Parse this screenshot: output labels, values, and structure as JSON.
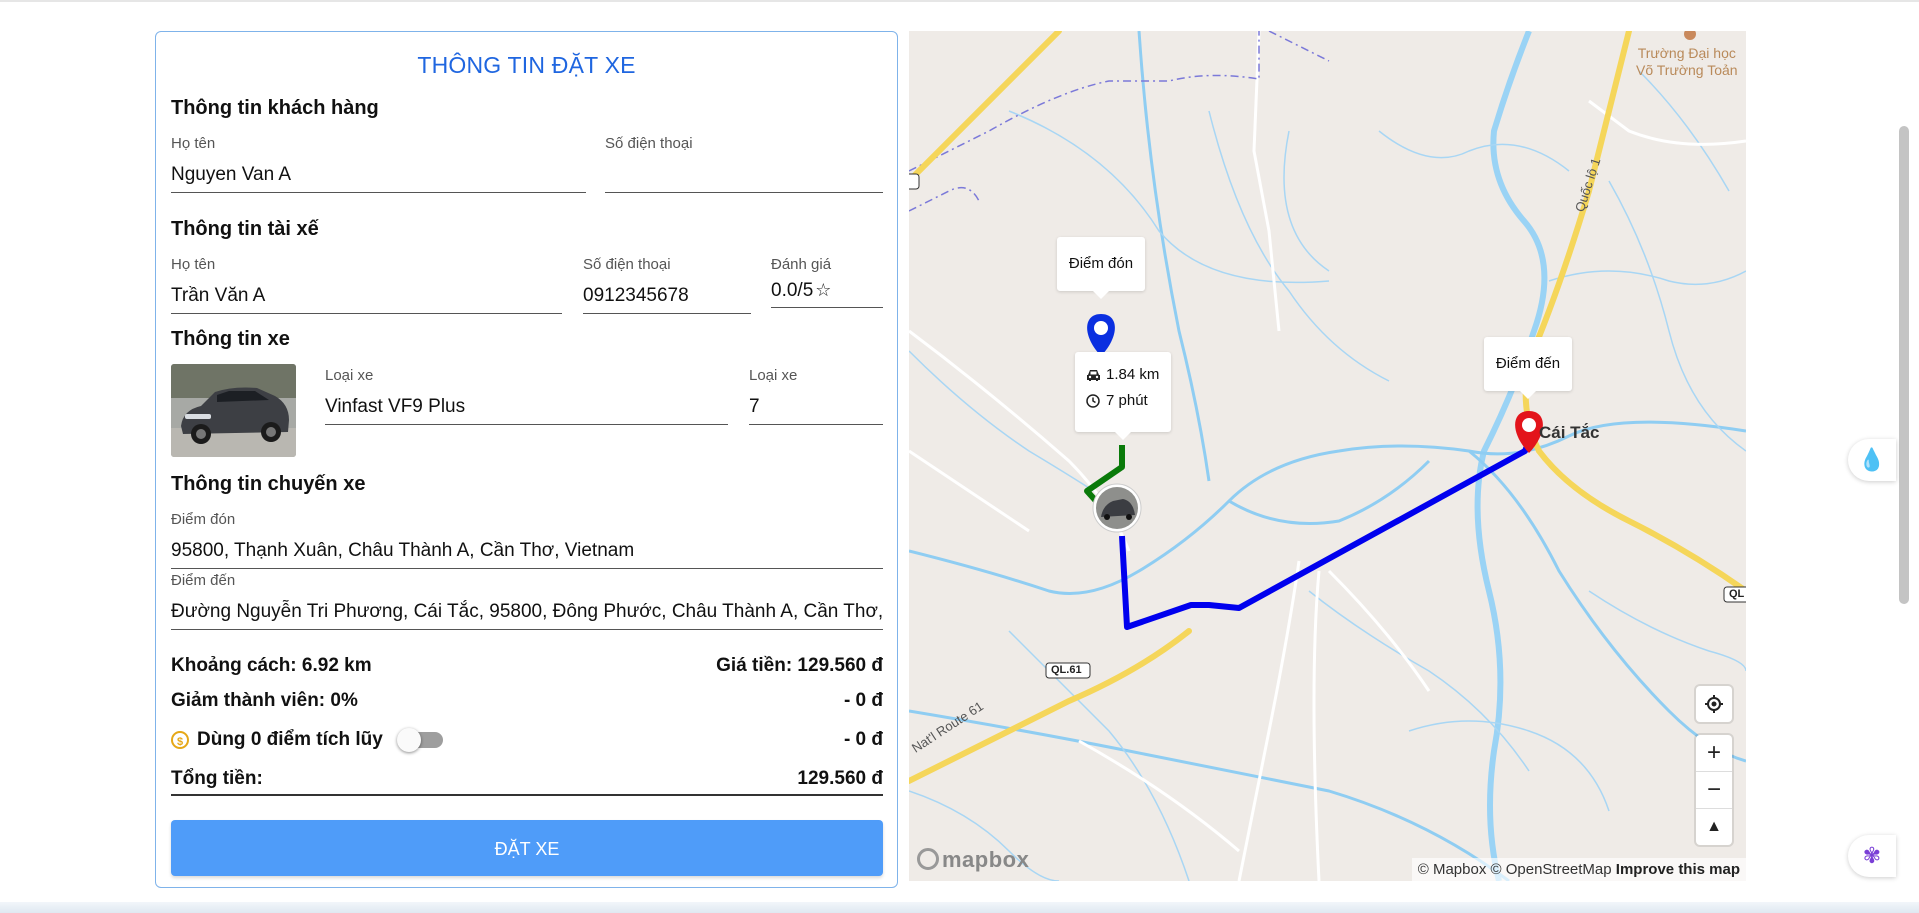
{
  "booking": {
    "title": "THÔNG TIN ĐẶT XE",
    "customer": {
      "section": "Thông tin khách hàng",
      "name_label": "Họ tên",
      "name": "Nguyen Van A",
      "phone_label": "Số điện thoại",
      "phone": ""
    },
    "driver": {
      "section": "Thông tin tài xế",
      "name_label": "Họ tên",
      "name": "Trần Văn A",
      "phone_label": "Số điện thoại",
      "phone": "0912345678",
      "rating_label": "Đánh giá",
      "rating": "0.0/5"
    },
    "vehicle": {
      "section": "Thông tin xe",
      "type_label": "Loại xe",
      "type": "Vinfast VF9 Plus",
      "seats_label": "Loại xe",
      "seats": "7"
    },
    "trip": {
      "section": "Thông tin chuyến xe",
      "pickup_label": "Điểm đón",
      "pickup": "95800, Thạnh Xuân, Châu Thành A, Cần Thơ, Vietnam",
      "dropoff_label": "Điểm đến",
      "dropoff": "Đường Nguyễn Tri Phương, Cái Tắc, 95800, Đông Phước, Châu Thành A, Cần Thơ, Vietnam"
    },
    "summary": {
      "distance": "Khoảng cách: 6.92 km",
      "price": "Giá tiền: 129.560 đ",
      "member_discount": "Giảm thành viên: 0%",
      "member_discount_value": "- 0 đ",
      "points": "Dùng 0 điểm tích lũy",
      "points_value": "- 0 đ",
      "total_label": "Tổng tiền:",
      "total": "129.560 đ"
    },
    "book_button": "ĐẶT XE"
  },
  "map": {
    "pickup_popup": "Điểm đón",
    "dropoff_popup": "Điểm đến",
    "driver_distance": "1.84 km",
    "driver_eta": "7 phút",
    "place_university": "Trường Đại học\nVõ Trường Toản",
    "place_town": "Cái Tắc",
    "road_ql61": "QL.61",
    "road_route61": "Nat'l Route 61",
    "road_quoc_lo_1": "Quốc lộ 1",
    "road_ql_right": "QL",
    "attribution_mapbox": "© Mapbox",
    "attribution_osm": "© OpenStreetMap",
    "improve": "Improve this map",
    "logo": "mapbox",
    "route_color": "#0000ee",
    "driver_route_color": "#0a7a0a",
    "pickup_marker_color": "#0a2fe0",
    "dropoff_marker_color": "#e3141b"
  },
  "colors": {
    "accent": "#1f66e0",
    "button": "#4f9cf9",
    "card_border": "#7fb3ea"
  }
}
